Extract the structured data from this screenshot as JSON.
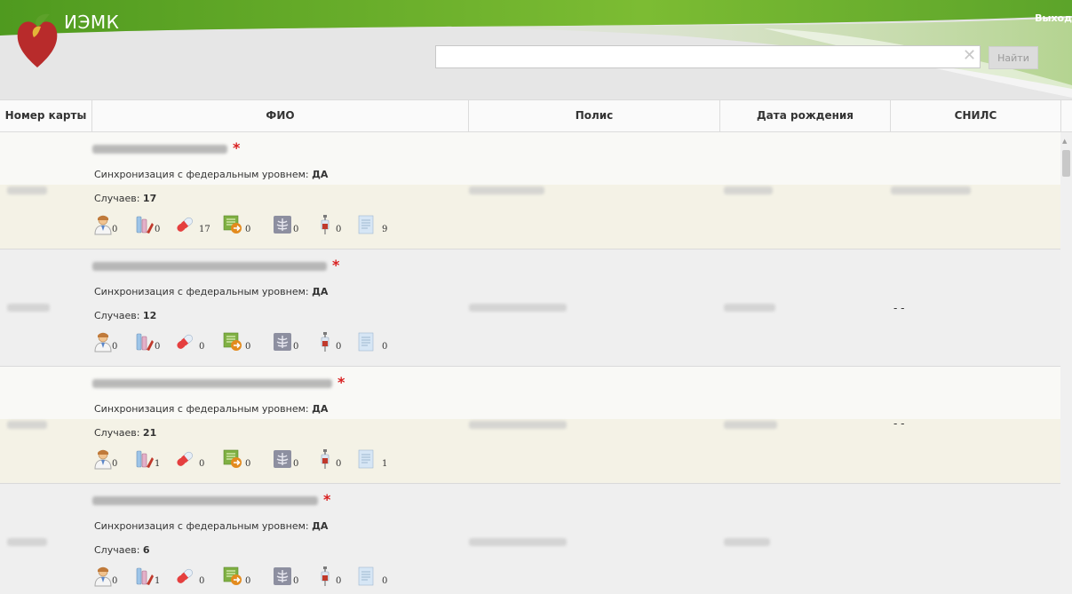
{
  "header": {
    "app_title": "ИЭМК",
    "logout_label": "Выход",
    "search": {
      "value": "",
      "placeholder": ""
    },
    "clear_symbol": "✕",
    "search_button_label": "Найти"
  },
  "table": {
    "columns": [
      "Номер карты",
      "ФИО",
      "Полис",
      "Дата рождения",
      "СНИЛС"
    ],
    "sync_label": "Синхронизация с федеральным уровнем:",
    "cases_label": "Случаев:",
    "rows": [
      {
        "sync_value": "ДА",
        "cases": "17",
        "snils": "",
        "counts": {
          "doctor": "0",
          "lab": "0",
          "medication": "17",
          "referral": "0",
          "xray": "0",
          "vaccine": "0",
          "document": "9"
        }
      },
      {
        "sync_value": "ДА",
        "cases": "12",
        "snils": "- -",
        "counts": {
          "doctor": "0",
          "lab": "0",
          "medication": "0",
          "referral": "0",
          "xray": "0",
          "vaccine": "0",
          "document": "0"
        }
      },
      {
        "sync_value": "ДА",
        "cases": "21",
        "snils": "- -",
        "counts": {
          "doctor": "0",
          "lab": "1",
          "medication": "0",
          "referral": "0",
          "xray": "0",
          "vaccine": "0",
          "document": "1"
        }
      },
      {
        "sync_value": "ДА",
        "cases": "6",
        "snils": "",
        "counts": {
          "doctor": "0",
          "lab": "1",
          "medication": "0",
          "referral": "0",
          "xray": "0",
          "vaccine": "0",
          "document": "0"
        }
      }
    ]
  },
  "icons": [
    "doctor-icon",
    "lab-results-icon",
    "medication-pill-icon",
    "referral-icon",
    "xray-icon",
    "vaccine-syringe-icon",
    "document-icon"
  ],
  "colors": {
    "header_green": "#6aab2e",
    "required_star": "#d92020",
    "row_stripe": "#f4f2e6"
  }
}
